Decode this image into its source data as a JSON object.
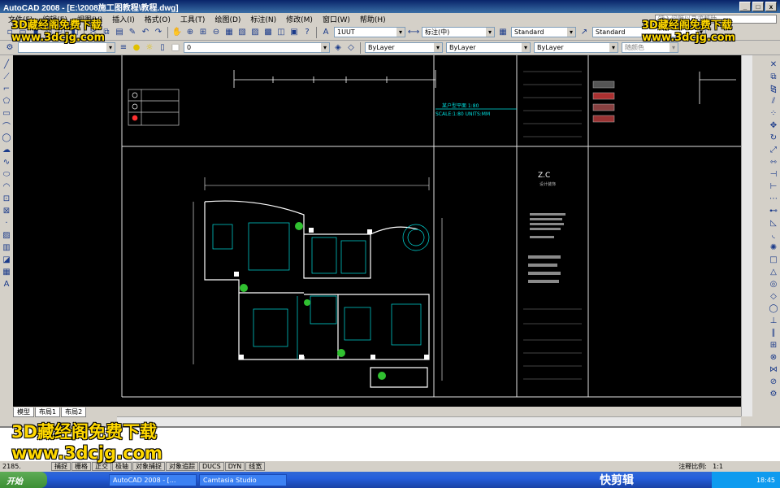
{
  "window": {
    "title": "AutoCAD 2008 - [E:\\2008施工图教程\\教程.dwg]",
    "controls": {
      "minimize": "_",
      "maximize": "□",
      "close": "x"
    }
  },
  "menu": {
    "items": [
      "文件(F)",
      "编辑(E)",
      "视图(V)",
      "插入(I)",
      "格式(O)",
      "工具(T)",
      "绘图(D)",
      "标注(N)",
      "修改(M)",
      "窗口(W)",
      "帮助(H)"
    ],
    "help_placeholder": "键入问题以寻求帮助"
  },
  "toolbar1": {
    "dim_style": "1UUT",
    "text_style": "标注(中)",
    "table_style": "Standard",
    "mleader_style": "Standard"
  },
  "toolbar2": {
    "layer": "0",
    "color": "ByLayer",
    "linetype": "ByLayer",
    "lineweight": "ByLayer",
    "plotstyle": "随颜色"
  },
  "drawing": {
    "scale_label": "某户型平面 1:80",
    "scale_text": "SCALE:1:80 UNITS:MM",
    "logo": "Z.C",
    "logo_sub": "设计装饰"
  },
  "layout_tabs": [
    "模型",
    "布局1",
    "布局2"
  ],
  "command": {
    "line1": "",
    "line2": ""
  },
  "status": {
    "coords": "2185.",
    "buttons": [
      "捕捉",
      "栅格",
      "正交",
      "极轴",
      "对象捕捉",
      "对象追踪",
      "DUCS",
      "DYN",
      "线宽"
    ],
    "scale_label": "注释比例:",
    "scale_value": "1:1"
  },
  "taskbar": {
    "start": "开始",
    "tasks": [
      "AutoCAD 2008 - [...",
      "Camtasia Studio"
    ],
    "clock": "18:45"
  },
  "watermarks": {
    "top_left_line1": "3D藏经阁免费下载",
    "top_left_line2": "www.3dcjg.com",
    "top_right_line1": "3D藏经阁免费下载",
    "top_right_line2": "www.3dcjg.com",
    "bottom_line1": "3D藏经阁免费下载",
    "bottom_line2": "www.3dcjg.com",
    "brand": "快剪辑"
  }
}
